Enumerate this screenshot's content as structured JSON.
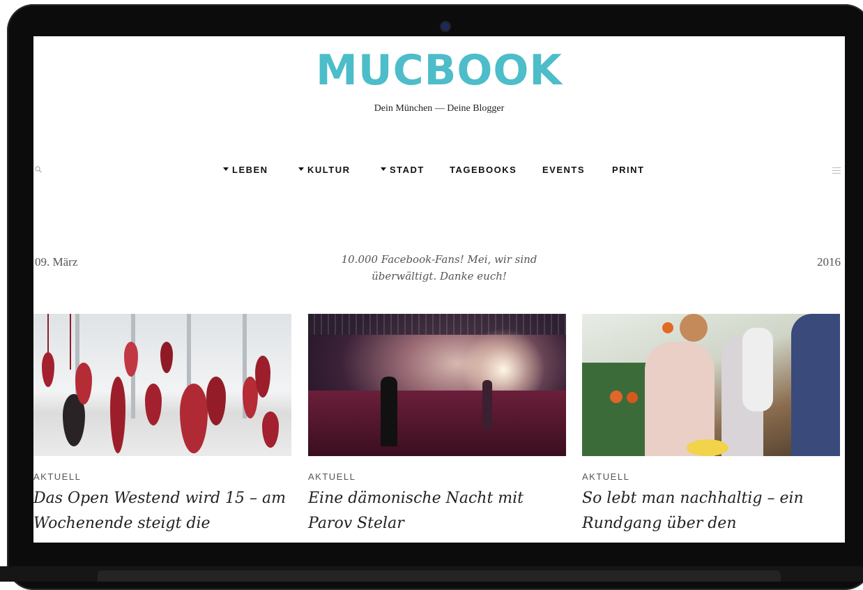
{
  "site": {
    "logo": "MUCBOOK",
    "tagline": "Dein München — Deine Blogger"
  },
  "nav": {
    "items": [
      {
        "label": "LEBEN",
        "dropdown": true
      },
      {
        "label": "KULTUR",
        "dropdown": true
      },
      {
        "label": "STADT",
        "dropdown": true
      },
      {
        "label": "TAGEBOOKS",
        "dropdown": false
      },
      {
        "label": "EVENTS",
        "dropdown": false
      },
      {
        "label": "PRINT",
        "dropdown": false
      }
    ],
    "search_icon": "search-icon",
    "menu_icon": "hamburger-menu-icon"
  },
  "featured": {
    "date_left": "09. März",
    "text": "10.000 Facebook-Fans! Mei, wir sind überwältigt. Danke euch!",
    "date_right": "2016"
  },
  "articles": [
    {
      "category": "AKTUELL",
      "title": "Das Open Westend wird 15 – am Wochenende steigt die"
    },
    {
      "category": "AKTUELL",
      "title": "Eine dämonische Nacht mit Parov Stelar"
    },
    {
      "category": "AKTUELL",
      "title": "So lebt man nachhaltig – ein Rundgang über den"
    }
  ],
  "colors": {
    "logo": "#4cbdc9",
    "text": "#222222"
  }
}
